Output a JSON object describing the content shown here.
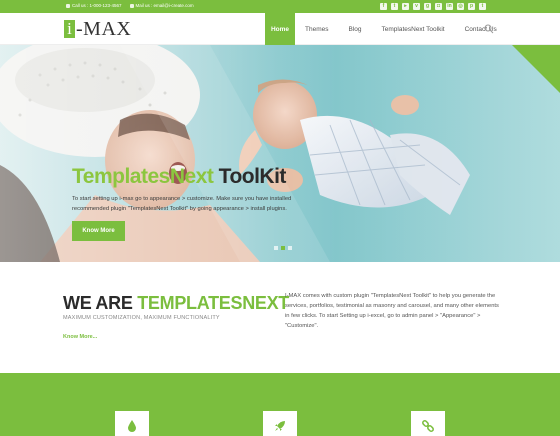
{
  "topbar": {
    "call": "Call us : 1-000-123-4567",
    "email": "Mail us : email@i-create.com",
    "socials": [
      "facebook-icon",
      "twitter-icon",
      "youtube-icon",
      "vimeo-icon",
      "googleplus-icon",
      "instagram-icon",
      "linkedin-icon",
      "dribbble-icon",
      "pinterest-icon",
      "tumblr-icon"
    ]
  },
  "logo": {
    "letter": "i",
    "text": "-MAX"
  },
  "nav": {
    "items": [
      {
        "label": "Home",
        "active": true
      },
      {
        "label": "Themes"
      },
      {
        "label": "Blog"
      },
      {
        "label": "TemplatesNext Toolkit"
      },
      {
        "label": "Contact Us"
      }
    ]
  },
  "hero": {
    "title_green": "TemplatesNext",
    "title_dark": " ToolKit",
    "text": "To start setting up i-max go to appearance > customize. Make sure you have installed recommended plugin \"TemplatesNext Toolkit\" by going appearance > install plugins.",
    "button": "Know More"
  },
  "intro": {
    "title_dark": "WE ARE ",
    "title_green": "TEMPLATESNEXT",
    "subtitle": "MAXIMUM CUSTOMIZATION, MAXIMUM FUNCTIONALITY",
    "link": "Know More...",
    "paragraph": "I-MAX comes with custom plugin \"TemplatesNext Toolkit\" to help you generate the services, portfolios, testimonial as masonry and carousel, and many other elements in few clicks. To start Setting up i-excel, go to admin panel > \"Appearance\" > \"Customize\"."
  },
  "features": [
    "drop-icon",
    "rocket-icon",
    "link-icon"
  ],
  "colors": {
    "accent": "#7bbe3e",
    "dark": "#2b2b2b"
  }
}
